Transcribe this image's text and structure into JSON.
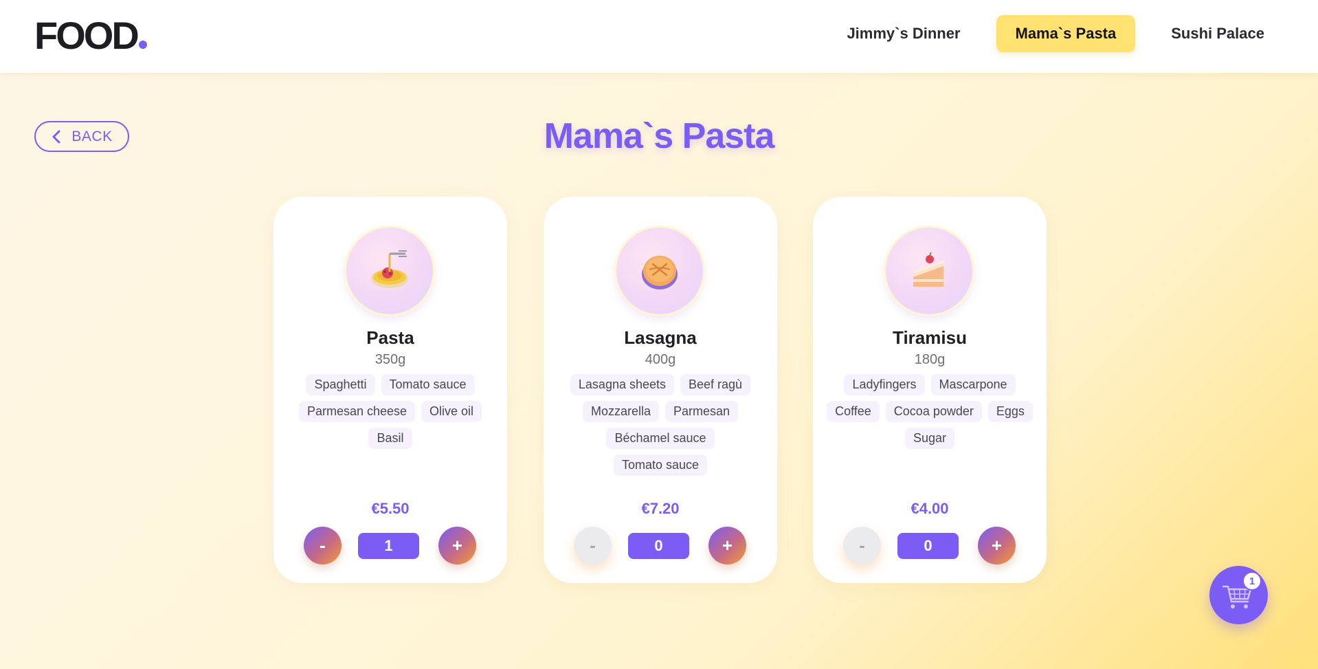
{
  "header": {
    "logo_text": "FOOD",
    "nav": [
      {
        "label": "Jimmy`s Dinner",
        "active": false
      },
      {
        "label": "Mama`s Pasta",
        "active": true
      },
      {
        "label": "Sushi Palace",
        "active": false
      }
    ]
  },
  "back_button": {
    "label": "BACK",
    "icon": "chevron-left-icon"
  },
  "page_title": "Mama`s Pasta",
  "menu": [
    {
      "name": "Pasta",
      "weight": "350g",
      "icon": "spaghetti-icon",
      "ingredients": [
        "Spaghetti",
        "Tomato sauce",
        "Parmesan cheese",
        "Olive oil",
        "Basil"
      ],
      "price": "€5.50",
      "quantity": "1",
      "minus_enabled": true,
      "minus_label": "-",
      "plus_label": "+"
    },
    {
      "name": "Lasagna",
      "weight": "400g",
      "icon": "lasagna-icon",
      "ingredients": [
        "Lasagna sheets",
        "Beef ragù",
        "Mozzarella",
        "Parmesan",
        "Béchamel sauce",
        "Tomato sauce"
      ],
      "price": "€7.20",
      "quantity": "0",
      "minus_enabled": false,
      "minus_label": "-",
      "plus_label": "+"
    },
    {
      "name": "Tiramisu",
      "weight": "180g",
      "icon": "cake-slice-icon",
      "ingredients": [
        "Ladyfingers",
        "Mascarpone",
        "Coffee",
        "Cocoa powder",
        "Eggs",
        "Sugar"
      ],
      "price": "€4.00",
      "quantity": "0",
      "minus_enabled": false,
      "minus_label": "-",
      "plus_label": "+"
    }
  ],
  "cart": {
    "count": "1",
    "icon": "shopping-cart-icon"
  },
  "colors": {
    "accent": "#7b5cf5",
    "nav_active": "#ffe271",
    "background": "#fff6dc"
  }
}
